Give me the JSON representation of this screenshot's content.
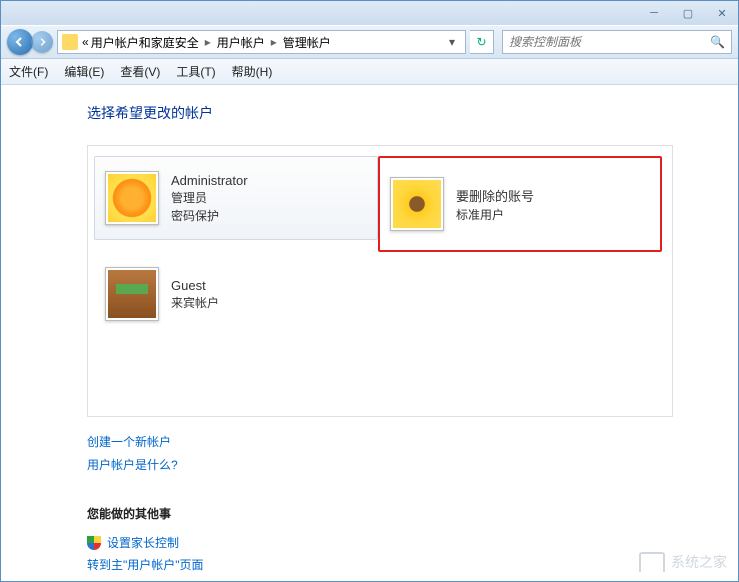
{
  "breadcrumb": {
    "prefix": "«",
    "items": [
      "用户帐户和家庭安全",
      "用户帐户",
      "管理帐户"
    ]
  },
  "search": {
    "placeholder": "搜索控制面板"
  },
  "menu": {
    "file": "文件(F)",
    "edit": "编辑(E)",
    "view": "查看(V)",
    "tools": "工具(T)",
    "help": "帮助(H)"
  },
  "page_title": "选择希望更改的帐户",
  "accounts": [
    {
      "name": "Administrator",
      "role": "管理员",
      "extra": "密码保护"
    },
    {
      "name": "要删除的账号",
      "role": "标准用户",
      "extra": ""
    },
    {
      "name": "Guest",
      "role": "来宾帐户",
      "extra": ""
    }
  ],
  "links": {
    "create": "创建一个新帐户",
    "whatis": "用户帐户是什么?"
  },
  "other_section": {
    "title": "您能做的其他事",
    "parental": "设置家长控制",
    "goto_main": "转到主\"用户帐户\"页面"
  },
  "watermark": "系统之家"
}
